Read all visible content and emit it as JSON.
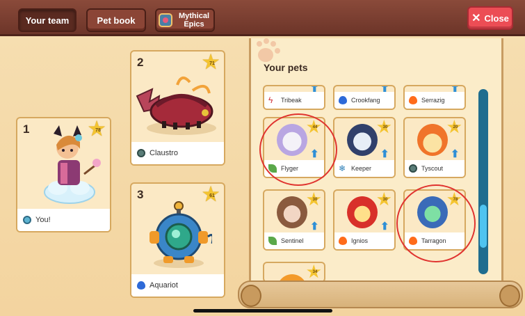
{
  "tabs": [
    {
      "label": "Your team",
      "active": true
    },
    {
      "label": "Pet book",
      "active": false
    },
    {
      "label": "Mythical Epics",
      "active": false
    }
  ],
  "close_label": "Close",
  "team": [
    {
      "slot": "1",
      "name": "You!",
      "level": "78",
      "element": "star-icon"
    },
    {
      "slot": "2",
      "name": "Claustro",
      "level": "71",
      "element": "shadow-icon"
    },
    {
      "slot": "3",
      "name": "Aquariot",
      "level": "61",
      "element": "water-icon"
    }
  ],
  "panel_title": "Your pets",
  "pets": [
    {
      "name": "Tribeak",
      "element": "storm-icon"
    },
    {
      "name": "Crookfang",
      "element": "water-icon"
    },
    {
      "name": "Serrazig",
      "element": "fire-icon"
    },
    {
      "name": "Flyger",
      "level": "44",
      "element": "plant-icon"
    },
    {
      "name": "Keeper",
      "level": "30",
      "element": "ice-icon"
    },
    {
      "name": "Tyscout",
      "level": "20",
      "element": "shadow-icon"
    },
    {
      "name": "Sentinel",
      "level": "30",
      "element": "plant-icon"
    },
    {
      "name": "Ignios",
      "level": "30",
      "element": "fire-icon"
    },
    {
      "name": "Tarragon",
      "level": "78",
      "element": "fire-icon"
    },
    {
      "name": "",
      "level": "34",
      "element": ""
    }
  ],
  "colors": {
    "topbar": "#6d3529",
    "close": "#ec4d55",
    "card_bg": "#fbe9c5",
    "scrollbar": "#4fc4f0",
    "highlight": "#e0332f"
  }
}
